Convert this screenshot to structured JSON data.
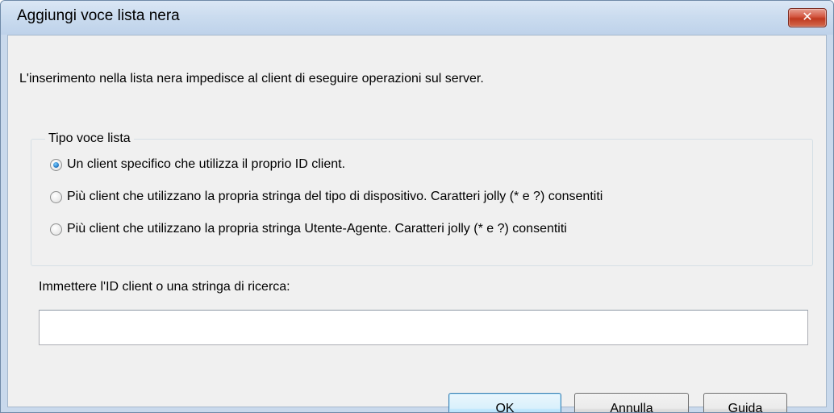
{
  "window": {
    "title": "Aggiungi voce lista nera",
    "close_glyph": "✕"
  },
  "description": "L'inserimento nella lista nera impedisce al client di eseguire operazioni sul server.",
  "list_type_group": {
    "legend": "Tipo voce lista",
    "options": [
      {
        "label": "Un client specifico che utilizza il proprio ID client.",
        "checked": true
      },
      {
        "label": "Più client che utilizzano la propria stringa del tipo di dispositivo. Caratteri jolly (* e ?) consentiti",
        "checked": false
      },
      {
        "label": "Più client che utilizzano la propria stringa Utente-Agente. Caratteri jolly (* e ?) consentiti",
        "checked": false
      }
    ]
  },
  "search_field": {
    "label": "Immettere l'ID client o una stringa di ricerca:",
    "value": ""
  },
  "buttons": {
    "ok": "OK",
    "cancel": "Annulla",
    "help": "Guida"
  },
  "colors": {
    "title_bar": "#cbdcef",
    "dialog_bg": "#f0f0f0",
    "close_button": "#c0391f",
    "radio_selected": "#1b6fbe"
  },
  "icons": {
    "close": "close-icon"
  }
}
